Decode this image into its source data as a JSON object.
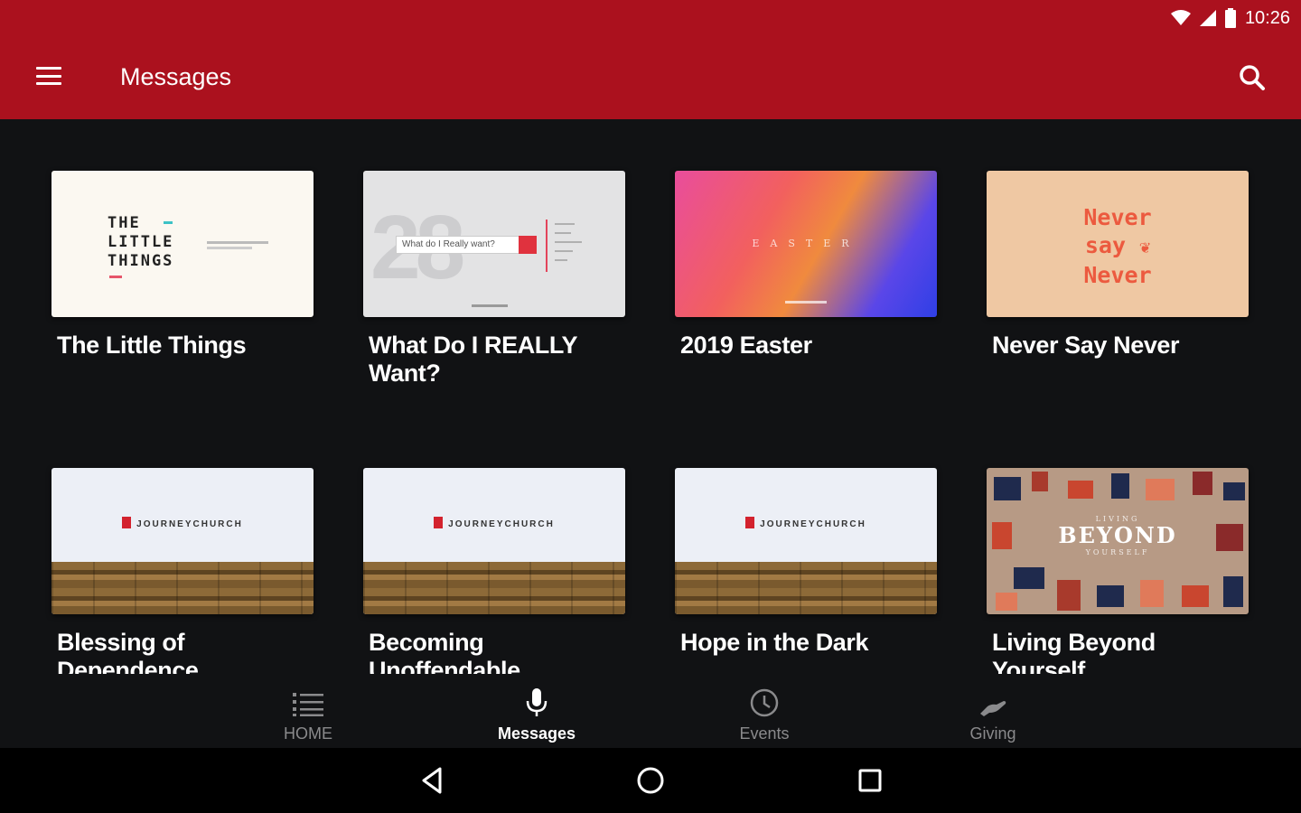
{
  "status_bar": {
    "time": "10:26",
    "icons": [
      "wifi-icon",
      "cell-signal-icon",
      "battery-icon"
    ]
  },
  "app_bar": {
    "title": "Messages",
    "menu_icon": "hamburger-menu-icon",
    "search_icon": "search-icon",
    "color": "#ab111e"
  },
  "cards": [
    {
      "title": "The Little Things",
      "thumb_text": "THE\nLITTLE\nTHINGS"
    },
    {
      "title": "What Do I REALLY Want?",
      "thumb_number": "28",
      "thumb_text": "What do I Really want?"
    },
    {
      "title": "2019 Easter",
      "thumb_text": "EASTER"
    },
    {
      "title": "Never Say Never",
      "thumb_text": "Never\nsay\nNever"
    },
    {
      "title": "Blessing of Dependence",
      "thumb_text": "JOURNEYCHURCH"
    },
    {
      "title": "Becoming Unoffendable",
      "thumb_text": "JOURNEYCHURCH"
    },
    {
      "title": "Hope in the Dark",
      "thumb_text": "JOURNEYCHURCH"
    },
    {
      "title": "Living Beyond Yourself",
      "thumb_text": [
        "LIVING",
        "BEYOND",
        "YOURSELF"
      ]
    }
  ],
  "bottom_nav": [
    {
      "label": "HOME",
      "icon": "list-icon",
      "active": false
    },
    {
      "label": "Messages",
      "icon": "microphone-icon",
      "active": true
    },
    {
      "label": "Events",
      "icon": "clock-icon",
      "active": false
    },
    {
      "label": "Giving",
      "icon": "giving-hand-icon",
      "active": false
    }
  ],
  "system_nav": [
    "back-icon",
    "home-circle-icon",
    "recents-square-icon"
  ]
}
